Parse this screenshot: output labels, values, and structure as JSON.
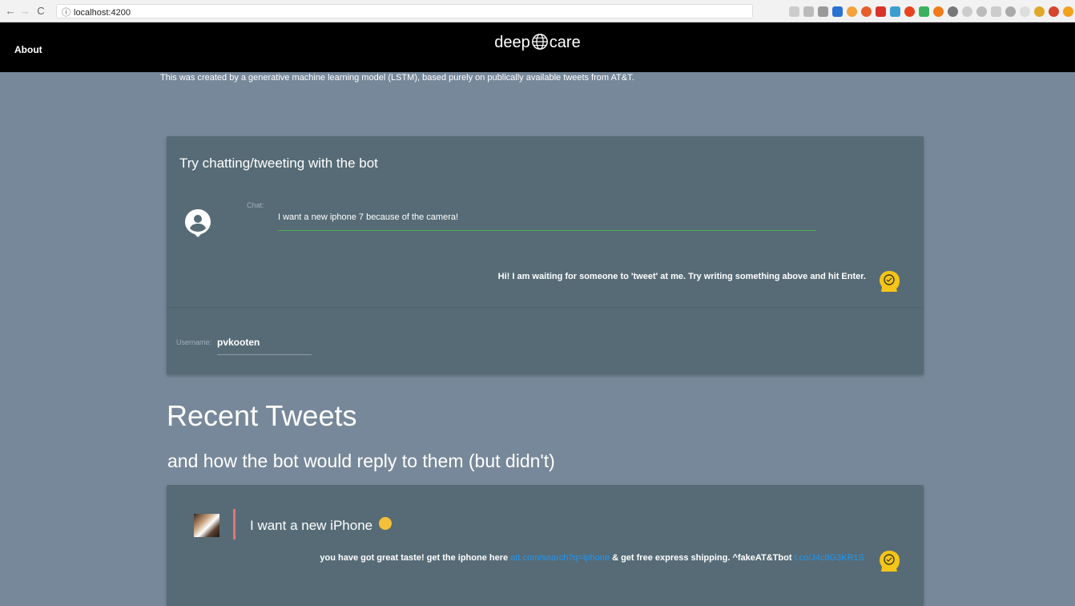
{
  "browser": {
    "back": "←",
    "forward": "→",
    "reload": "C",
    "url": "localhost:4200"
  },
  "appbar": {
    "about_label": "About",
    "logo_left": "deep",
    "logo_right": "care"
  },
  "subtitle": "This was created by a generative machine learning model (LSTM), based purely on publically available tweets from AT&T.",
  "chat_card": {
    "title": "Try chatting/tweeting with the bot",
    "chat_label": "Chat:",
    "chat_value": "I want a new iphone 7 because of the camera!",
    "bot_message": "Hi! I am waiting for someone to 'tweet' at me. Try writing something above and hit Enter.",
    "username_label": "Username:",
    "username_value": "pvkooten"
  },
  "recent": {
    "title": "Recent Tweets",
    "subtitle": "and how the bot would reply to them (but didn't)"
  },
  "tweet": {
    "text": "I want a new iPhone",
    "reply_prefix": "you have got great taste! get the iphone here ",
    "reply_link1": "att.com/search?q=iphone",
    "reply_middle": " & get free express shipping. ^fakeAT&Tbot ",
    "reply_link2": "t.co/J4c8G3KR1S",
    "footer_left": "",
    "footer_right": ""
  },
  "colors": {
    "page_bg": "#77889a",
    "card_bg": "#566b76",
    "accent_green": "#4caf50",
    "link_blue": "#2196f3",
    "quote_bar": "#e5737a",
    "bot_icon": "#f5c518"
  }
}
